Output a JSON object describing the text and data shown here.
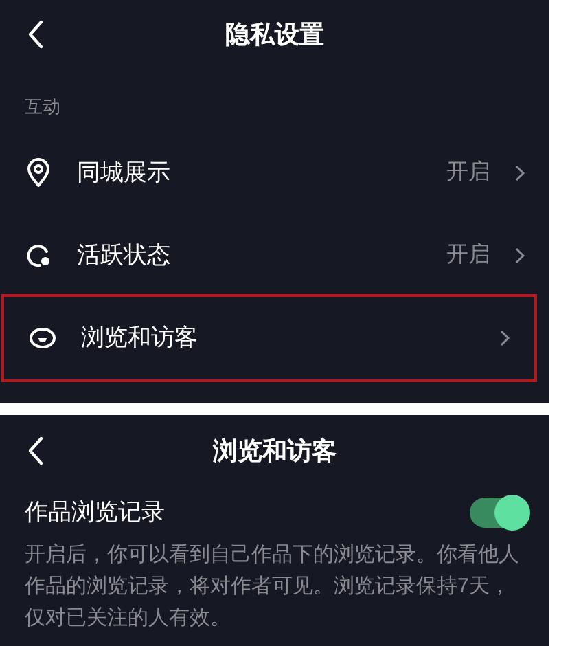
{
  "privacy_screen": {
    "title": "隐私设置",
    "section": "互动",
    "items": [
      {
        "kind": "location",
        "label": "同城展示",
        "value": "开启",
        "highlighted": false
      },
      {
        "kind": "activity",
        "label": "活跃状态",
        "value": "开启",
        "highlighted": false
      },
      {
        "kind": "eye",
        "label": "浏览和访客",
        "highlighted": true
      }
    ]
  },
  "visitors_screen": {
    "title": "浏览和访客",
    "setting": {
      "label": "作品浏览记录",
      "on": true,
      "description": "开启后，你可以看到自己作品下的浏览记录。你看他人作品的浏览记录，将对作者可见。浏览记录保持7天，仅对已关注的人有效。"
    }
  }
}
